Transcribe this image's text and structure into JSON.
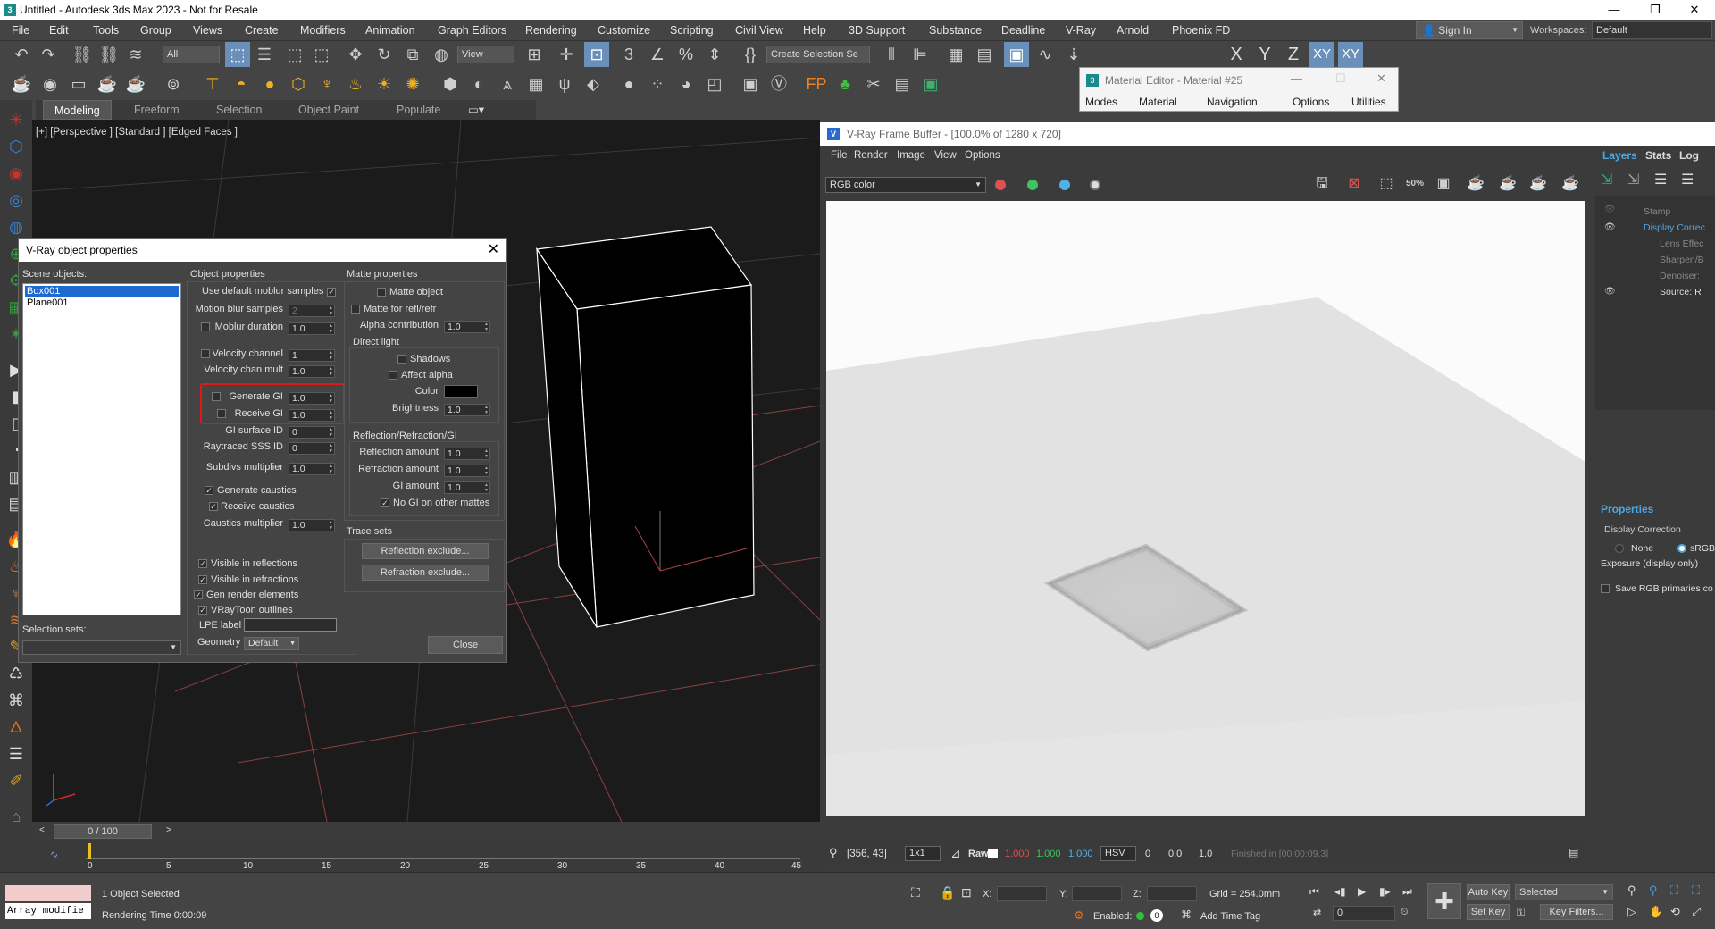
{
  "window": {
    "title": "Untitled - Autodesk 3ds Max 2023 - Not for Resale",
    "controls": [
      "—",
      "❐",
      "✕"
    ]
  },
  "menu": [
    "File",
    "Edit",
    "Tools",
    "Group",
    "Views",
    "Create",
    "Modifiers",
    "Animation",
    "Graph Editors",
    "Rendering",
    "Customize",
    "Scripting",
    "Civil View",
    "Help",
    "3D Support",
    "Substance",
    "Deadline",
    "V-Ray",
    "Arnold",
    "Phoenix FD"
  ],
  "signin": "Sign In",
  "workspaces": {
    "label": "Workspaces:",
    "value": "Default"
  },
  "toolbar": {
    "filter": "All",
    "view_dropdown": "View",
    "selection_set": "Create Selection Se",
    "axis_labels": [
      "X",
      "Y",
      "Z",
      "XY",
      "XY"
    ]
  },
  "ribbon_tabs": [
    "Modeling",
    "Freeform",
    "Selection",
    "Object Paint",
    "Populate"
  ],
  "viewport_label": "[+] [Perspective ] [Standard ] [Edged Faces ]",
  "vray_dialog": {
    "title": "V-Ray object properties",
    "close_x": "✕",
    "scene_objects_label": "Scene objects:",
    "scene_objects": [
      "Box001",
      "Plane001"
    ],
    "selection_sets_label": "Selection sets:",
    "object_properties": {
      "header": "Object properties",
      "use_default_moblur": "Use default moblur samples",
      "motion_blur_samples": {
        "label": "Motion blur samples",
        "value": "2"
      },
      "moblur_duration": {
        "label": "Moblur duration",
        "value": "1.0"
      },
      "velocity_channel": {
        "label": "Velocity channel",
        "value": "1"
      },
      "velocity_chan_mult": {
        "label": "Velocity chan mult",
        "value": "1.0"
      },
      "generate_gi": {
        "label": "Generate GI",
        "value": "1.0"
      },
      "receive_gi": {
        "label": "Receive GI",
        "value": "1.0"
      },
      "gi_surface_id": {
        "label": "GI surface ID",
        "value": "0"
      },
      "raytraced_sss_id": {
        "label": "Raytraced SSS ID",
        "value": "0"
      },
      "subdivs_multiplier": {
        "label": "Subdivs multiplier",
        "value": "1.0"
      },
      "generate_caustics": "Generate caustics",
      "receive_caustics": "Receive caustics",
      "caustics_multiplier": {
        "label": "Caustics multiplier",
        "value": "1.0"
      },
      "visible_in_reflections": "Visible in reflections",
      "visible_in_refractions": "Visible in refractions",
      "gen_render_elements": "Gen render elements",
      "vraytoon_outlines": "VRayToon outlines",
      "lpe_label": "LPE label",
      "geometry": {
        "label": "Geometry",
        "value": "Default"
      }
    },
    "matte_properties": {
      "header": "Matte properties",
      "matte_object": "Matte object",
      "matte_refl": "Matte for refl/refr",
      "alpha_contribution": {
        "label": "Alpha contribution",
        "value": "1.0"
      },
      "direct_light": "Direct light",
      "shadows": "Shadows",
      "affect_alpha": "Affect alpha",
      "color": "Color",
      "brightness": {
        "label": "Brightness",
        "value": "1.0"
      },
      "rrgi_header": "Reflection/Refraction/GI",
      "reflection_amount": {
        "label": "Reflection amount",
        "value": "1.0"
      },
      "refraction_amount": {
        "label": "Refraction amount",
        "value": "1.0"
      },
      "gi_amount": {
        "label": "GI amount",
        "value": "1.0"
      },
      "no_gi_other_mattes": "No GI on other mattes"
    },
    "trace_sets": {
      "header": "Trace sets",
      "reflection_exclude": "Reflection exclude...",
      "refraction_exclude": "Refraction exclude..."
    },
    "close_button": "Close"
  },
  "material_editor": {
    "title": "Material Editor - Material #25",
    "menu": [
      "Modes",
      "Material",
      "Navigation",
      "Options",
      "Utilities"
    ]
  },
  "vfb": {
    "title": "V-Ray Frame Buffer - [100.0% of 1280 x 720]",
    "menu": [
      "File",
      "Render",
      "Image",
      "View",
      "Options"
    ],
    "channel": "RGB color",
    "status": {
      "coords": "[356, 43]",
      "zoom": "1x1",
      "raw": "Raw",
      "r": "1.000",
      "g": "1.000",
      "b": "1.000",
      "mode": "HSV",
      "v1": "0",
      "v2": "0.0",
      "v3": "1.0",
      "finished": "Finished in [00:00:09.3]"
    },
    "side_tabs": [
      "Layers",
      "Stats",
      "Log"
    ],
    "layers": [
      "Stamp",
      "Display Correc",
      "Lens Effec",
      "Sharpen/B",
      "Denoiser:",
      "Source: R"
    ],
    "properties_header": "Properties",
    "display_correction": "Display Correction",
    "none": "None",
    "srgb": "sRGB",
    "exposure": "Exposure (display only)",
    "save_rgb": "Save RGB primaries co"
  },
  "timeline": {
    "position": "0 / 100",
    "ticks": [
      "0",
      "5",
      "10",
      "15",
      "20",
      "25",
      "30",
      "35",
      "40",
      "45"
    ]
  },
  "status": {
    "maxscript": "Array modifie",
    "selected": "1 Object Selected",
    "render_time": "Rendering Time  0:00:09",
    "x_label": "X:",
    "y_label": "Y:",
    "z_label": "Z:",
    "grid": "Grid = 254.0mm",
    "enabled": "Enabled:",
    "add_time_tag": "Add Time Tag",
    "auto_key": "Auto Key",
    "set_key": "Set Key",
    "selected_dd": "Selected",
    "key_filters": "Key Filters...",
    "frame": "0"
  },
  "colors": {
    "highlight_red": "#e01818",
    "accent_blue": "#3aa0e8",
    "selection_blue": "#1e6ad0"
  }
}
